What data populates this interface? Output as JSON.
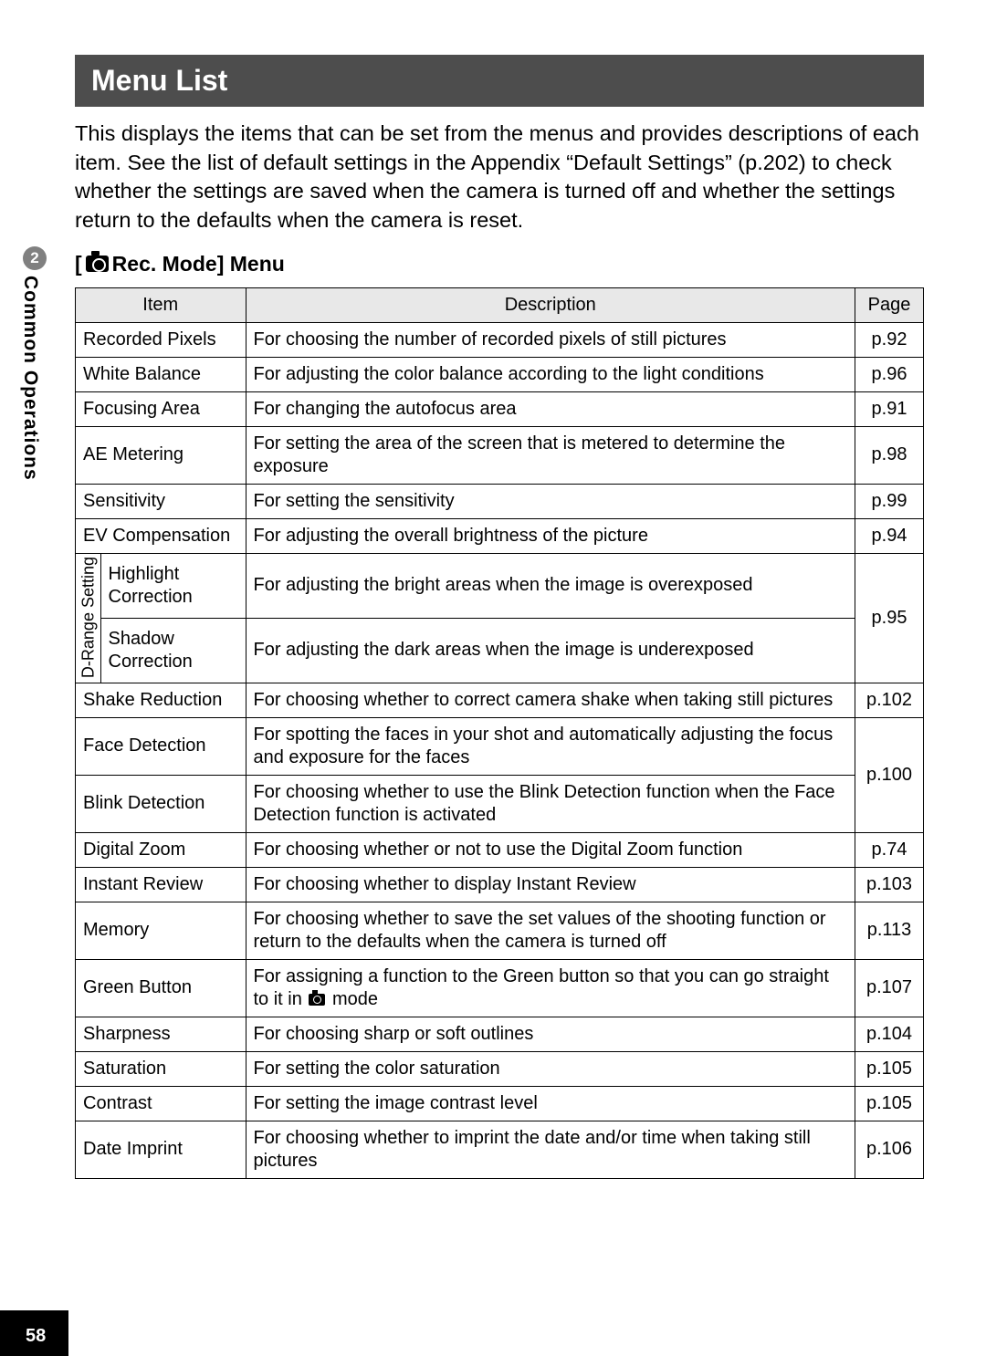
{
  "page_number": "58",
  "chapter_number": "2",
  "chapter_title": "Common Operations",
  "title": "Menu List",
  "intro": "This displays the items that can be set from the menus and provides descriptions of each item. See the list of default settings in the Appendix “Default Settings” (p.202) to check whether the settings are saved when the camera is turned off and whether the settings return to the defaults when the camera is reset.",
  "subhead_prefix": "[",
  "subhead_text": " Rec. Mode] Menu",
  "headers": {
    "item": "Item",
    "description": "Description",
    "page": "Page"
  },
  "group_label": "D-Range Setting",
  "rows": {
    "recorded_pixels": {
      "item": "Recorded Pixels",
      "desc": "For choosing the number of recorded pixels of still pictures",
      "page": "p.92"
    },
    "white_balance": {
      "item": "White Balance",
      "desc": "For adjusting the color balance according to the light conditions",
      "page": "p.96"
    },
    "focusing_area": {
      "item": "Focusing Area",
      "desc": "For changing the autofocus area",
      "page": "p.91"
    },
    "ae_metering": {
      "item": "AE Metering",
      "desc": "For setting the area of the screen that is metered to determine the exposure",
      "page": "p.98"
    },
    "sensitivity": {
      "item": "Sensitivity",
      "desc": "For setting the sensitivity",
      "page": "p.99"
    },
    "ev_compensation": {
      "item": "EV Compensation",
      "desc": "For adjusting the overall brightness of the picture",
      "page": "p.94"
    },
    "highlight_correction": {
      "item": "Highlight Correction",
      "desc": "For adjusting the bright areas when the image is overexposed"
    },
    "shadow_correction": {
      "item": "Shadow Correction",
      "desc": "For adjusting the dark areas when the image is underexposed"
    },
    "drange_page": "p.95",
    "shake_reduction": {
      "item": "Shake Reduction",
      "desc": "For choosing whether to correct camera shake when taking still pictures",
      "page": "p.102"
    },
    "face_detection": {
      "item": "Face Detection",
      "desc": "For spotting the faces in your shot and automatically adjusting the focus and exposure for the faces"
    },
    "blink_detection": {
      "item": "Blink Detection",
      "desc": "For choosing whether to use the Blink Detection function when the Face Detection function is activated"
    },
    "face_blink_page": "p.100",
    "digital_zoom": {
      "item": "Digital Zoom",
      "desc": "For choosing whether or not to use the Digital Zoom function",
      "page": "p.74"
    },
    "instant_review": {
      "item": "Instant Review",
      "desc": "For choosing whether to display Instant Review",
      "page": "p.103"
    },
    "memory": {
      "item": "Memory",
      "desc": "For choosing whether to save the set values of the shooting function or return to the defaults when the camera is turned off",
      "page": "p.113"
    },
    "green_button": {
      "item": "Green Button",
      "desc_pre": "For assigning a function to the Green button so that you can go straight to it in ",
      "desc_post": " mode",
      "page": "p.107"
    },
    "sharpness": {
      "item": "Sharpness",
      "desc": "For choosing sharp or soft outlines",
      "page": "p.104"
    },
    "saturation": {
      "item": "Saturation",
      "desc": "For setting the color saturation",
      "page": "p.105"
    },
    "contrast": {
      "item": "Contrast",
      "desc": "For setting the image contrast level",
      "page": "p.105"
    },
    "date_imprint": {
      "item": "Date Imprint",
      "desc": "For choosing whether to imprint the date and/or time when taking still pictures",
      "page": "p.106"
    }
  }
}
